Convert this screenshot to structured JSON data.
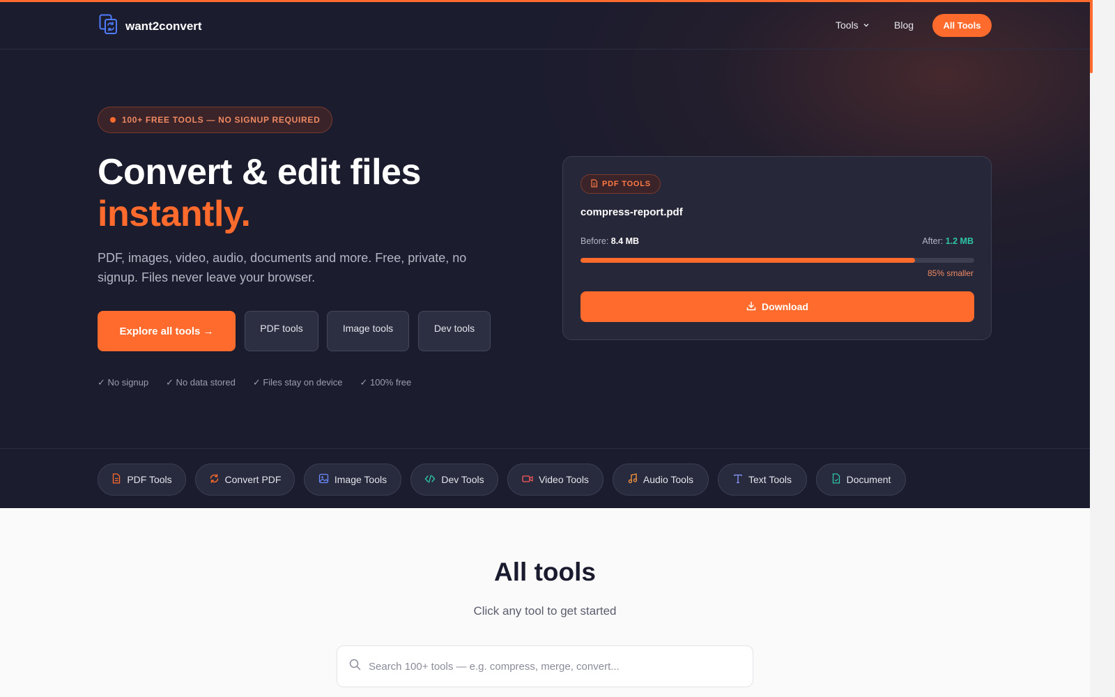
{
  "brand": {
    "name": "want2convert",
    "accent": "#ff6b2c",
    "dark_bg": "#1b1c2e"
  },
  "nav": {
    "tools": "Tools",
    "blog": "Blog",
    "all_tools": "All Tools"
  },
  "hero": {
    "badge": "100+ FREE TOOLS — NO SIGNUP REQUIRED",
    "title_line1": "Convert & edit files",
    "title_line2": "instantly.",
    "subtitle": "PDF, images, video, audio, documents and more. Free, private, no signup. Files never leave your browser.",
    "cta_primary": "Explore all tools →",
    "cta_pdf": "PDF tools",
    "cta_image": "Image tools",
    "cta_dev": "Dev tools",
    "checks": [
      "✓ No signup",
      "✓ No data stored",
      "✓ Files stay on device",
      "✓ 100% free"
    ]
  },
  "card": {
    "tag": "PDF TOOLS",
    "filename": "compress-report.pdf",
    "before_label": "Before:",
    "before_value": "8.4 MB",
    "after_label": "After:",
    "after_value": "1.2 MB",
    "progress": 0.85,
    "percent_label": "85% smaller",
    "download": "Download"
  },
  "categories": [
    {
      "label": "PDF Tools",
      "icon": "file-icon",
      "color": "#ff6b2c"
    },
    {
      "label": "Convert PDF",
      "icon": "refresh-icon",
      "color": "#ff6b2c"
    },
    {
      "label": "Image Tools",
      "icon": "image-icon",
      "color": "#6b8cff"
    },
    {
      "label": "Dev Tools",
      "icon": "code-icon",
      "color": "#2ec4a6"
    },
    {
      "label": "Video Tools",
      "icon": "video-icon",
      "color": "#ff5a5a"
    },
    {
      "label": "Audio Tools",
      "icon": "music-icon",
      "color": "#ff9a3c"
    },
    {
      "label": "Text Tools",
      "icon": "text-icon",
      "color": "#8a9cff"
    },
    {
      "label": "Document",
      "icon": "document-icon",
      "color": "#2ec4a6"
    }
  ],
  "all_tools": {
    "title": "All tools",
    "subtitle": "Click any tool to get started",
    "search_placeholder": "Search 100+ tools — e.g. compress, merge, convert..."
  }
}
